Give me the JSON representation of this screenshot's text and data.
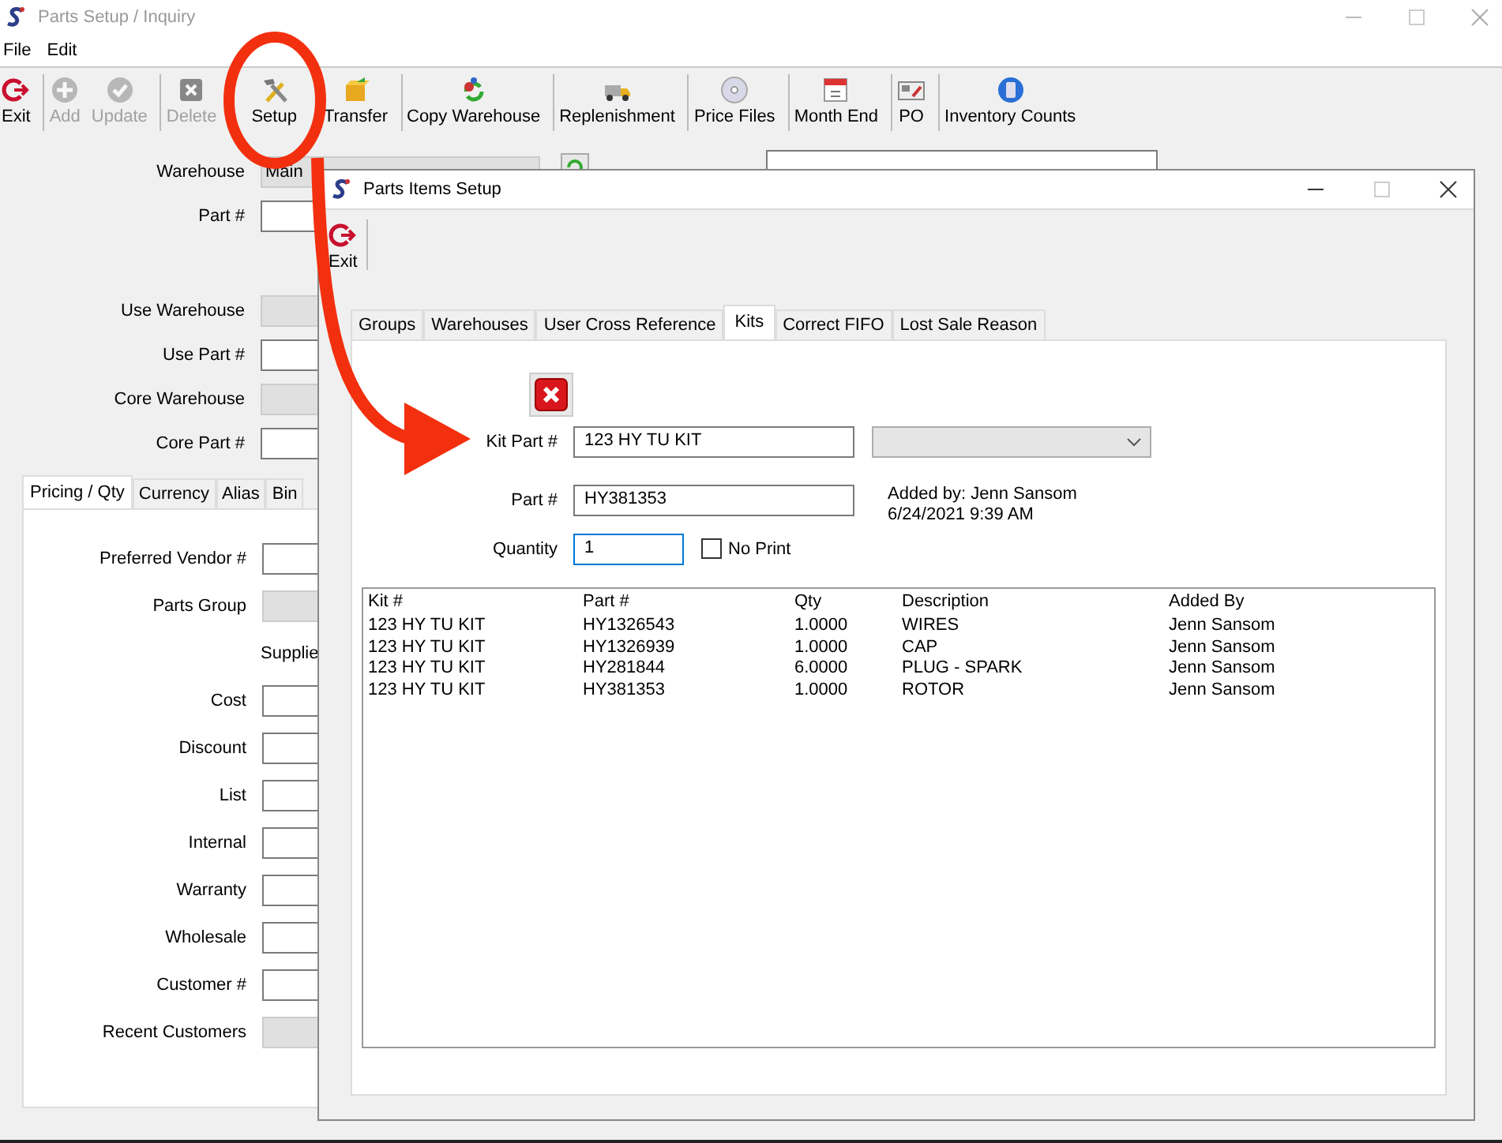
{
  "window": {
    "title": "Parts Setup / Inquiry"
  },
  "menu": [
    "File",
    "Edit"
  ],
  "toolbar": [
    {
      "label": "Exit",
      "disabled": false,
      "separator_after": true,
      "highlighted": false
    },
    {
      "label": "Add",
      "disabled": true,
      "separator_after": false,
      "highlighted": false
    },
    {
      "label": "Update",
      "disabled": true,
      "separator_after": true,
      "highlighted": false
    },
    {
      "label": "Delete",
      "disabled": true,
      "separator_after": false,
      "highlighted": false
    },
    {
      "label": "Setup",
      "disabled": false,
      "separator_after": false,
      "highlighted": true
    },
    {
      "label": "Transfer",
      "disabled": false,
      "separator_after": true,
      "highlighted": false
    },
    {
      "label": "Copy Warehouse",
      "disabled": false,
      "separator_after": true,
      "highlighted": false
    },
    {
      "label": "Replenishment",
      "disabled": false,
      "separator_after": true,
      "highlighted": false
    },
    {
      "label": "Price Files",
      "disabled": false,
      "separator_after": true,
      "highlighted": false
    },
    {
      "label": "Month End",
      "disabled": false,
      "separator_after": true,
      "highlighted": false
    },
    {
      "label": "PO",
      "disabled": false,
      "separator_after": true,
      "highlighted": false
    },
    {
      "label": "Inventory Counts",
      "disabled": false,
      "separator_after": false,
      "highlighted": false
    }
  ],
  "main_fields": [
    {
      "label": "Warehouse",
      "kind": "readonly",
      "value": "Main"
    },
    {
      "label": "Part #",
      "kind": "field"
    }
  ],
  "use_fields": [
    {
      "label": "Use Warehouse",
      "kind": "readonly"
    },
    {
      "label": "Use Part #",
      "kind": "field"
    },
    {
      "label": "Core Warehouse",
      "kind": "readonly"
    },
    {
      "label": "Core Part #",
      "kind": "field"
    }
  ],
  "tabs": [
    {
      "label": "Pricing / Qty",
      "selected": true
    },
    {
      "label": "Currency",
      "selected": false
    },
    {
      "label": "Alias",
      "selected": false
    },
    {
      "label": "Bin",
      "selected": false
    }
  ],
  "pricing_fields": [
    {
      "label": "Preferred Vendor #",
      "kind": "field"
    },
    {
      "label": "Parts Group",
      "kind": "readonly"
    },
    {
      "label": "Supplie",
      "kind": "heading"
    },
    {
      "label": "Cost",
      "kind": "field"
    },
    {
      "label": "Discount",
      "kind": "field"
    },
    {
      "label": "List",
      "kind": "field"
    },
    {
      "label": "Internal",
      "kind": "field"
    },
    {
      "label": "Warranty",
      "kind": "field"
    },
    {
      "label": "Wholesale",
      "kind": "field"
    },
    {
      "label": "Customer #",
      "kind": "field"
    },
    {
      "label": "Recent Customers",
      "kind": "readonly"
    }
  ],
  "dialog": {
    "title": "Parts Items Setup",
    "toolbar": [
      {
        "label": "Exit"
      }
    ],
    "tabs": [
      {
        "label": "Groups",
        "selected": false
      },
      {
        "label": "Warehouses",
        "selected": false
      },
      {
        "label": "User Cross Reference",
        "selected": false
      },
      {
        "label": "Kits",
        "selected": true
      },
      {
        "label": "Correct FIFO",
        "selected": false
      },
      {
        "label": "Lost Sale Reason",
        "selected": false
      }
    ],
    "kit_part": {
      "label": "Kit Part #",
      "value": "123 HY TU KIT"
    },
    "part": {
      "label": "Part #",
      "value": "HY381353"
    },
    "added_by": "Added by: Jenn Sansom",
    "added_on": "6/24/2021 9:39 AM",
    "quantity": {
      "label": "Quantity",
      "value": "1"
    },
    "no_print": {
      "label": "No Print",
      "checked": false
    },
    "table": {
      "columns": [
        "Kit #",
        "Part #",
        "Qty",
        "Description",
        "Added By"
      ],
      "rows": [
        [
          "123 HY TU KIT",
          "HY1326543",
          "1.0000",
          "WIRES",
          "Jenn Sansom"
        ],
        [
          "123 HY TU KIT",
          "HY1326939",
          "1.0000",
          "CAP",
          "Jenn Sansom"
        ],
        [
          "123 HY TU KIT",
          "HY281844",
          "6.0000",
          "PLUG - SPARK",
          "Jenn Sansom"
        ],
        [
          "123 HY TU KIT",
          "HY381353",
          "1.0000",
          "ROTOR",
          "Jenn Sansom"
        ]
      ]
    }
  }
}
